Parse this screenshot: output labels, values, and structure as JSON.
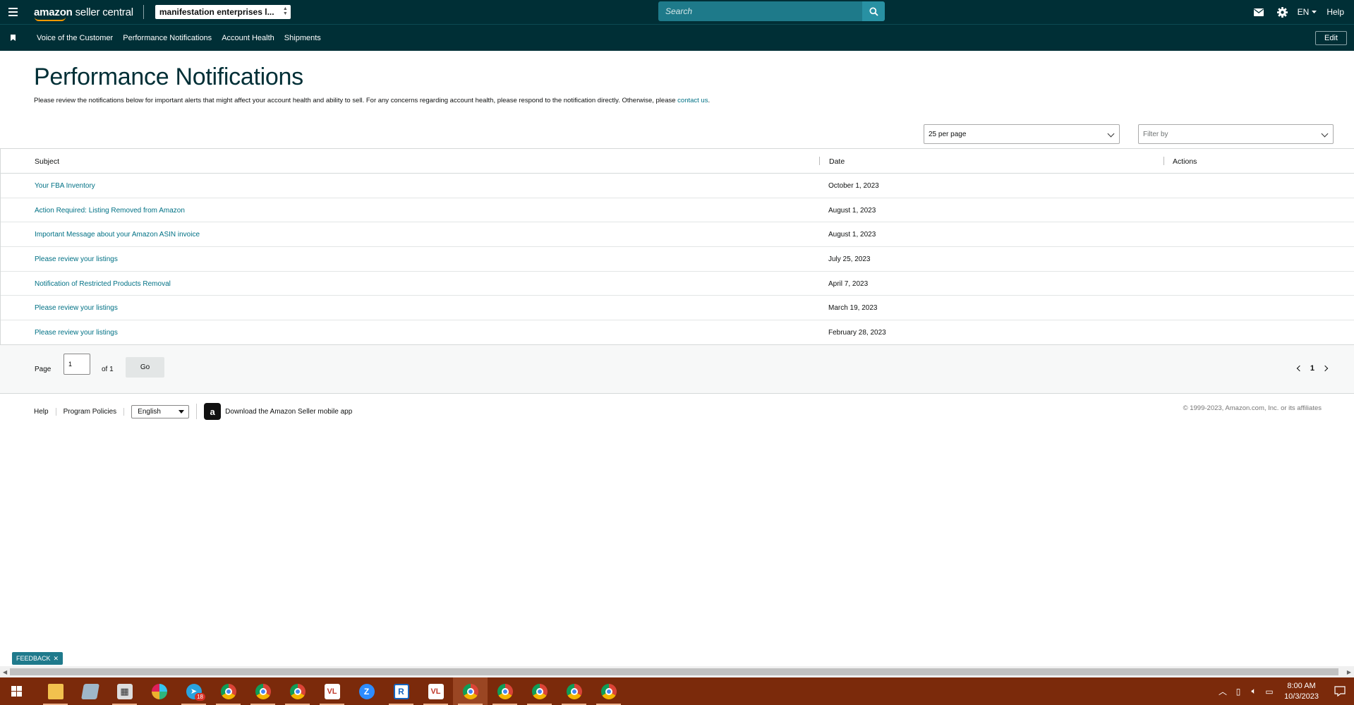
{
  "topbar": {
    "logo_text_a": "amazon",
    "logo_text_b": " seller central",
    "store_name": "manifestation enterprises l...",
    "search_placeholder": "Search",
    "lang": "EN",
    "help": "Help"
  },
  "navbar": {
    "links": [
      "Voice of the Customer",
      "Performance Notifications",
      "Account Health",
      "Shipments"
    ],
    "edit": "Edit"
  },
  "page": {
    "title": "Performance Notifications",
    "intro": "Please review the notifications below for important alerts that might affect your account health and ability to sell. For any concerns regarding account health, please respond to the notification directly. Otherwise, please ",
    "intro_link": "contact us",
    "intro_end": "."
  },
  "controls": {
    "per_page": "25 per page",
    "filter_placeholder": "Filter by"
  },
  "table": {
    "headers": {
      "subject": "Subject",
      "date": "Date",
      "actions": "Actions"
    },
    "rows": [
      {
        "subject": "Your FBA Inventory",
        "date": "October 1, 2023"
      },
      {
        "subject": "Action Required: Listing Removed from Amazon",
        "date": "August 1, 2023"
      },
      {
        "subject": "Important Message about your Amazon ASIN invoice",
        "date": "August 1, 2023"
      },
      {
        "subject": "Please review your listings",
        "date": "July 25, 2023"
      },
      {
        "subject": "Notification of Restricted Products Removal",
        "date": "April 7, 2023"
      },
      {
        "subject": "Please review your listings",
        "date": "March 19, 2023"
      },
      {
        "subject": "Please review your listings",
        "date": "February 28, 2023"
      }
    ]
  },
  "pager": {
    "page_label": "Page",
    "page_value": "1",
    "of_label": "of 1",
    "go": "Go",
    "current": "1"
  },
  "footer": {
    "help": "Help",
    "policies": "Program Policies",
    "language": "English",
    "app_link": "Download the Amazon Seller mobile app",
    "copyright": "© 1999-2023, Amazon.com, Inc. or its affiliates"
  },
  "feedback": "FEEDBACK",
  "taskbar": {
    "apps": [
      "file-explorer",
      "notes",
      "calculator",
      "slack",
      "telegram",
      "chrome",
      "chrome",
      "chrome",
      "app-icon",
      "zoom",
      "app-r",
      "app-icon",
      "chrome",
      "chrome",
      "chrome",
      "chrome",
      "chrome"
    ],
    "telegram_badge": "18",
    "time": "8:00 AM",
    "date": "10/3/2023"
  }
}
